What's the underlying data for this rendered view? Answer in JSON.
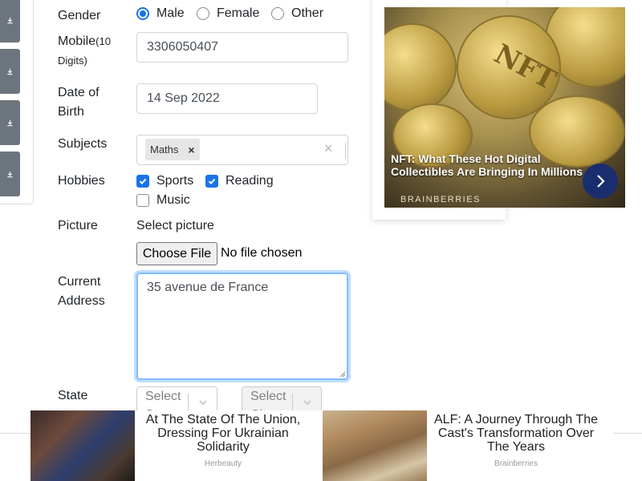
{
  "form": {
    "gender": {
      "label": "Gender",
      "options": [
        "Male",
        "Female",
        "Other"
      ],
      "selected": "Male"
    },
    "mobile": {
      "label": "Mobile",
      "hint": "(10",
      "hint2": "Digits)",
      "value": "3306050407"
    },
    "dob": {
      "label1": "Date of",
      "label2": "Birth",
      "value": "14 Sep 2022"
    },
    "subjects": {
      "label": "Subjects",
      "chips": [
        "Maths"
      ],
      "chip_remove": "×",
      "clear": "×"
    },
    "hobbies": {
      "label": "Hobbies",
      "options": [
        "Sports",
        "Reading",
        "Music"
      ],
      "checked": [
        "Sports",
        "Reading"
      ]
    },
    "picture": {
      "label": "Picture",
      "prompt": "Select picture",
      "button": "Choose File",
      "status": "No file chosen"
    },
    "address": {
      "label1": "Current",
      "label2": "Address",
      "value": "35 avenue de France"
    },
    "state": {
      "label": "State",
      "placeholder": "Select State"
    },
    "city": {
      "placeholder": "Select City"
    }
  },
  "side_buttons": [
    "download-icon",
    "download-icon",
    "download-icon",
    "download-icon"
  ],
  "ad_right": {
    "image_text": "NFT",
    "title": "NFT: What These Hot Digital Collectibles Are Bringing In Millions",
    "brand": "BRAINBERRIES",
    "accent": "#1a2e6e"
  },
  "bottom_ads": [
    {
      "title": "At The State Of The Union, Dressing For Ukrainian Solidarity",
      "source": "Herbeauty"
    },
    {
      "title": "ALF: A Journey Through The Cast's Transformation Over The Years",
      "source": "Brainberries"
    }
  ],
  "colors": {
    "primary": "#1a73e8",
    "focus": "#80bdff",
    "side": "#6c757d"
  }
}
